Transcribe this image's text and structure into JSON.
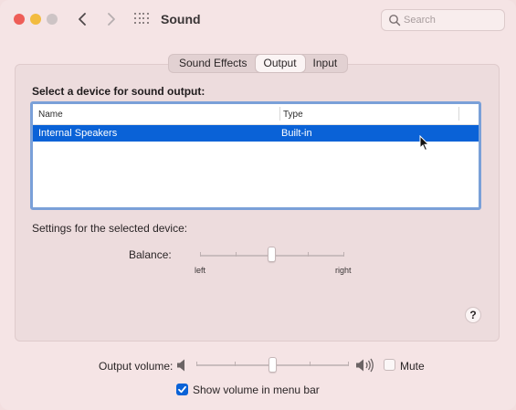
{
  "window": {
    "title": "Sound",
    "search_placeholder": "Search"
  },
  "tabs": [
    {
      "label": "Sound Effects",
      "active": false
    },
    {
      "label": "Output",
      "active": true
    },
    {
      "label": "Input",
      "active": false
    }
  ],
  "output": {
    "section_label": "Select a device for sound output:",
    "table": {
      "columns": [
        "Name",
        "Type"
      ],
      "rows": [
        {
          "name": "Internal Speakers",
          "type": "Built-in",
          "selected": true
        }
      ]
    },
    "settings_label": "Settings for the selected device:",
    "balance": {
      "label": "Balance:",
      "left_label": "left",
      "right_label": "right",
      "value": 0.5
    }
  },
  "help_label": "?",
  "volume": {
    "label": "Output volume:",
    "value": 0.5,
    "mute_label": "Mute",
    "muted": false,
    "show_in_menu_bar_label": "Show volume in menu bar",
    "show_in_menu_bar": true
  },
  "colors": {
    "selection": "#0a62d7",
    "table_focus": "#7aa0d8",
    "close": "#ee5d57",
    "minimize": "#f2bb3f"
  }
}
